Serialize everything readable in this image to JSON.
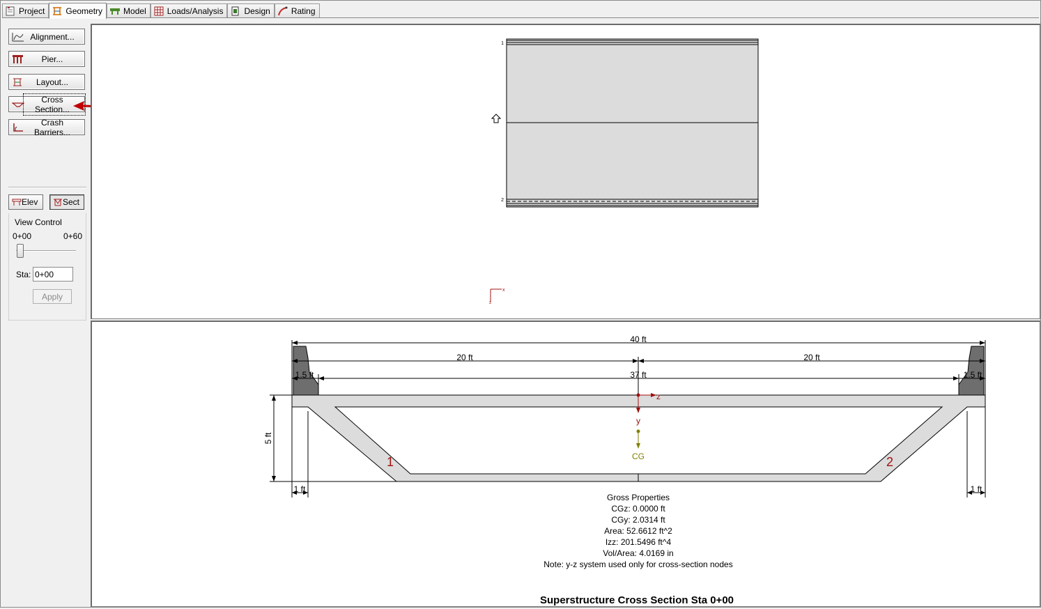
{
  "tabs": [
    {
      "label": "Project",
      "icon": "project-icon",
      "active": false
    },
    {
      "label": "Geometry",
      "icon": "geometry-icon",
      "active": true
    },
    {
      "label": "Model",
      "icon": "model-icon",
      "active": false
    },
    {
      "label": "Loads/Analysis",
      "icon": "loads-icon",
      "active": false
    },
    {
      "label": "Design",
      "icon": "design-icon",
      "active": false
    },
    {
      "label": "Rating",
      "icon": "rating-icon",
      "active": false
    }
  ],
  "sidebar": {
    "alignment": "Alignment...",
    "pier": "Pier...",
    "layout": "Layout...",
    "cross_section": "Cross Section...",
    "crash_barriers": "Crash Barriers...",
    "elev": "Elev",
    "sect": "Sect"
  },
  "view_control": {
    "title": "View Control",
    "range_min": "0+00",
    "range_max": "0+60",
    "slider_position": 0,
    "sta_label": "Sta:",
    "sta_value": "0+00",
    "apply": "Apply"
  },
  "cross_section": {
    "dims": {
      "total_width": "40 ft",
      "half_left": "20 ft",
      "half_right": "20 ft",
      "barrier_left": "1.5 ft",
      "barrier_right": "1.5 ft",
      "clear_width": "37 ft",
      "depth": "5 ft",
      "overhang_left": "1 ft",
      "overhang_right": "1 ft"
    },
    "axis_z": "z",
    "axis_y": "y",
    "cg_label": "CG",
    "web_labels": [
      "1",
      "2"
    ],
    "properties": {
      "heading": "Gross Properties",
      "cgz": "CGz:  0.0000 ft",
      "cgy": "CGy:  2.0314 ft",
      "area": "Area:  52.6612 ft^2",
      "izz": "Izz:  201.5496 ft^4",
      "vol_area": "Vol/Area:  4.0169 in",
      "note": "Note: y-z system used only for cross-section nodes"
    },
    "title": "Superstructure Cross Section Sta 0+00"
  },
  "plan_view": {
    "axis_x": "x",
    "line_labels": [
      "1",
      "2"
    ]
  },
  "colors": {
    "deck_fill": "#dcdcdc",
    "barrier_fill": "#6e6e6e",
    "web_label": "#a01010",
    "node": "#a01010",
    "cg": "#808000",
    "arrow": "#c00000"
  }
}
